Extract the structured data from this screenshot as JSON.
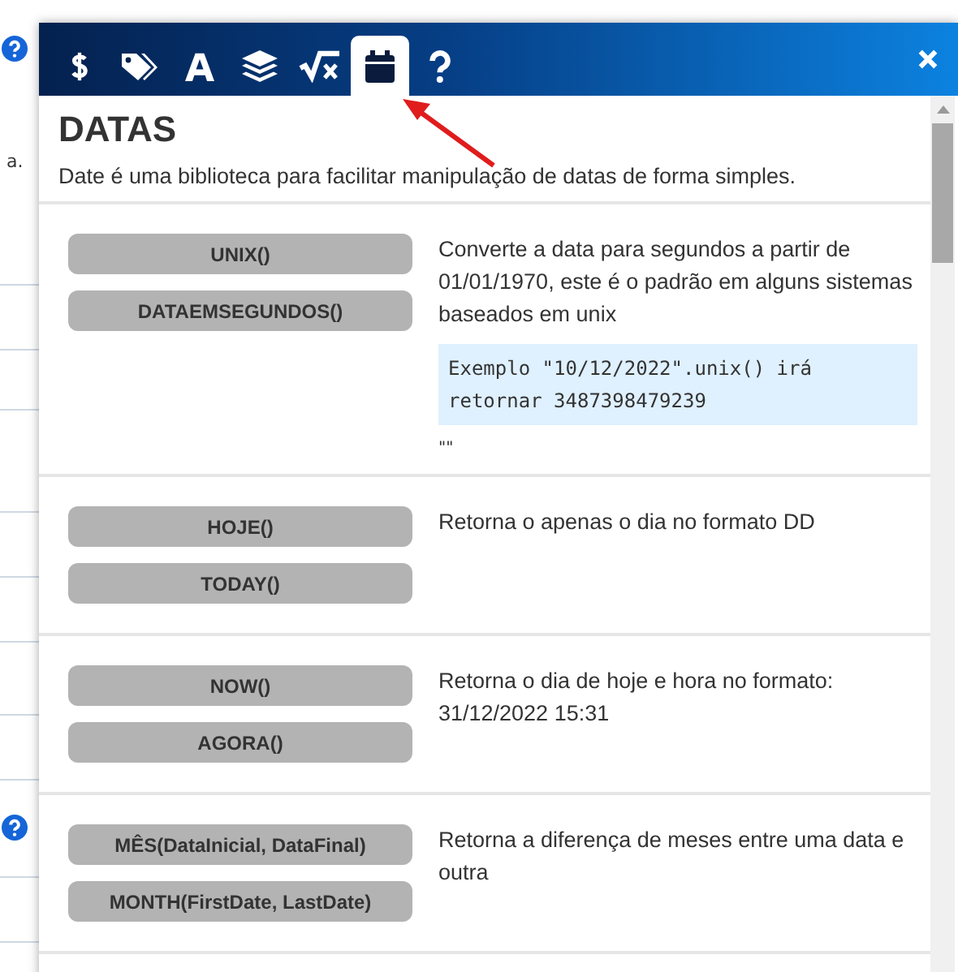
{
  "background": {
    "fragment": "a."
  },
  "dialog": {
    "tabs": [
      {
        "kind": "dollar",
        "selected": false
      },
      {
        "kind": "tags",
        "selected": false
      },
      {
        "kind": "font",
        "selected": false
      },
      {
        "kind": "layers",
        "selected": false
      },
      {
        "kind": "sqrt",
        "selected": false
      },
      {
        "kind": "calendar",
        "selected": true
      },
      {
        "kind": "help",
        "selected": false
      }
    ],
    "title": "DATAS",
    "description": "Date é uma biblioteca para facilitar manipulação de datas de forma simples.",
    "entries": [
      {
        "functions": [
          "UNIX()",
          "DATAEMSEGUNDOS()"
        ],
        "description": "Converte a data para segundos a partir de 01/01/1970, este é o padrão em alguns sistemas baseados em unix",
        "example": "Exemplo \"10/12/2022\".unix() irá retornar 3487398479239",
        "note": "\"\""
      },
      {
        "functions": [
          "HOJE()",
          "TODAY()"
        ],
        "description": "Retorna o apenas o dia no formato DD"
      },
      {
        "functions": [
          "NOW()",
          "AGORA()"
        ],
        "description": "Retorna o dia de hoje e hora no formato: 31/12/2022 15:31"
      },
      {
        "functions": [
          "MÊS(DataInicial, DataFinal)",
          "MONTH(FirstDate, LastDate)"
        ],
        "description": "Retorna a diferença de meses entre uma data e outra"
      }
    ]
  }
}
